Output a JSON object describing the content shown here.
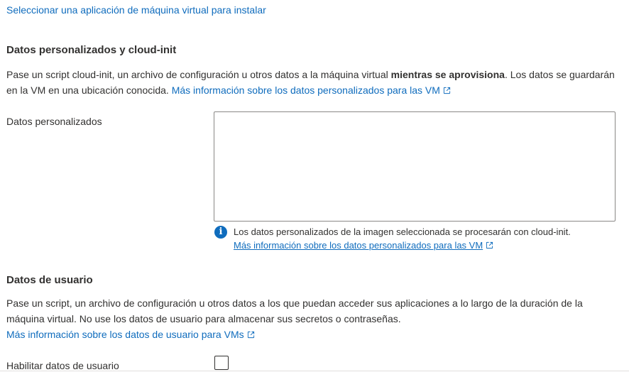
{
  "top_link": "Seleccionar una aplicación de máquina virtual para instalar",
  "custom_data_section": {
    "title": "Datos personalizados y cloud-init",
    "desc_part1": "Pase un script cloud-init, un archivo de configuración u otros datos a la máquina virtual ",
    "desc_bold": "mientras se aprovisiona",
    "desc_part2": ". Los datos se guardarán en la VM en una ubicación conocida. ",
    "desc_link": "Más información sobre los datos personalizados para las VM",
    "field_label": "Datos personalizados",
    "field_value": "",
    "info_text": "Los datos personalizados de la imagen seleccionada se procesarán con cloud-init.",
    "info_link": "Más información sobre los datos personalizados para las VM"
  },
  "user_data_section": {
    "title": "Datos de usuario",
    "desc": "Pase un script, un archivo de configuración u otros datos a los que puedan acceder sus aplicaciones a lo largo de la duración de la máquina virtual. No use los datos de usuario para almacenar sus secretos o contraseñas.",
    "desc_link": "Más información sobre los datos de usuario para VMs",
    "checkbox_label": "Habilitar datos de usuario",
    "checkbox_checked": false
  },
  "icons": {
    "external": "external-link-icon",
    "info": "info-icon"
  },
  "colors": {
    "link": "#0f6cbd",
    "text": "#323130",
    "info_icon": "#0f6cbd"
  }
}
